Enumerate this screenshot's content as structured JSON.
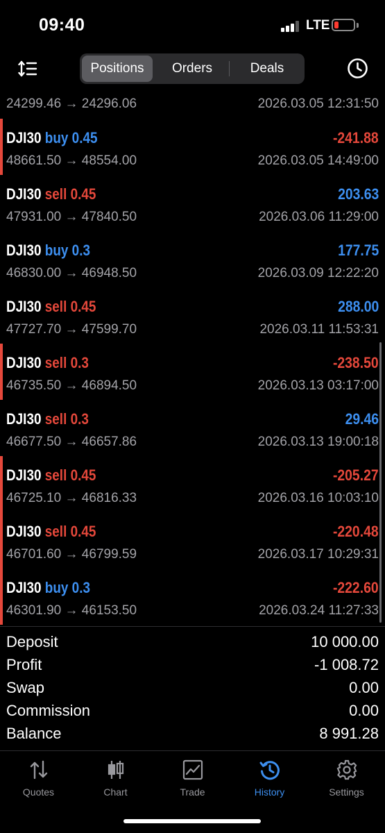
{
  "status_bar": {
    "time": "09:40",
    "network": "LTE",
    "battery_level": 0.15,
    "battery_color": "#ff3b30"
  },
  "header": {
    "sort_icon": "sort-icon",
    "tabs": [
      {
        "label": "Positions",
        "active": true
      },
      {
        "label": "Orders",
        "active": false
      },
      {
        "label": "Deals",
        "active": false
      }
    ],
    "history_icon": "clock-icon"
  },
  "positions": [
    {
      "symbol": "",
      "side": "",
      "volume": "",
      "prices": "24299.46 → 24296.06",
      "date": "2026.03.05 12:31:50",
      "profit": "",
      "partial": true
    },
    {
      "symbol": "DJI30",
      "side": "buy",
      "volume": "0.45",
      "prices": "48661.50 → 48554.00",
      "date": "2026.03.05 14:49:00",
      "profit": "-241.88",
      "loss": true
    },
    {
      "symbol": "DJI30",
      "side": "sell",
      "volume": "0.45",
      "prices": "47931.00 → 47840.50",
      "date": "2026.03.06 11:29:00",
      "profit": "203.63",
      "loss": false
    },
    {
      "symbol": "DJI30",
      "side": "buy",
      "volume": "0.3",
      "prices": "46830.00 → 46948.50",
      "date": "2026.03.09 12:22:20",
      "profit": "177.75",
      "loss": false
    },
    {
      "symbol": "DJI30",
      "side": "sell",
      "volume": "0.45",
      "prices": "47727.70 → 47599.70",
      "date": "2026.03.11 11:53:31",
      "profit": "288.00",
      "loss": false
    },
    {
      "symbol": "DJI30",
      "side": "sell",
      "volume": "0.3",
      "prices": "46735.50 → 46894.50",
      "date": "2026.03.13 03:17:00",
      "profit": "-238.50",
      "loss": true
    },
    {
      "symbol": "DJI30",
      "side": "sell",
      "volume": "0.3",
      "prices": "46677.50 → 46657.86",
      "date": "2026.03.13 19:00:18",
      "profit": "29.46",
      "loss": false
    },
    {
      "symbol": "DJI30",
      "side": "sell",
      "volume": "0.45",
      "prices": "46725.10 → 46816.33",
      "date": "2026.03.16 10:03:10",
      "profit": "-205.27",
      "loss": true
    },
    {
      "symbol": "DJI30",
      "side": "sell",
      "volume": "0.45",
      "prices": "46701.60 → 46799.59",
      "date": "2026.03.17 10:29:31",
      "profit": "-220.48",
      "loss": true
    },
    {
      "symbol": "DJI30",
      "side": "buy",
      "volume": "0.3",
      "prices": "46301.90 → 46153.50",
      "date": "2026.03.24 11:27:33",
      "profit": "-222.60",
      "loss": true
    }
  ],
  "summary": {
    "deposit_label": "Deposit",
    "deposit": "10 000.00",
    "profit_label": "Profit",
    "profit": "-1 008.72",
    "swap_label": "Swap",
    "swap": "0.00",
    "commission_label": "Commission",
    "commission": "0.00",
    "balance_label": "Balance",
    "balance": "8 991.28"
  },
  "tabbar": [
    {
      "label": "Quotes",
      "icon": "quotes-icon",
      "active": false
    },
    {
      "label": "Chart",
      "icon": "chart-icon",
      "active": false
    },
    {
      "label": "Trade",
      "icon": "trade-icon",
      "active": false
    },
    {
      "label": "History",
      "icon": "history-icon",
      "active": true
    },
    {
      "label": "Settings",
      "icon": "settings-icon",
      "active": false
    }
  ],
  "colors": {
    "accent_blue": "#3d8ff0",
    "loss_red": "#e5483b",
    "muted_text": "#a3a3a8",
    "background": "#000000"
  }
}
